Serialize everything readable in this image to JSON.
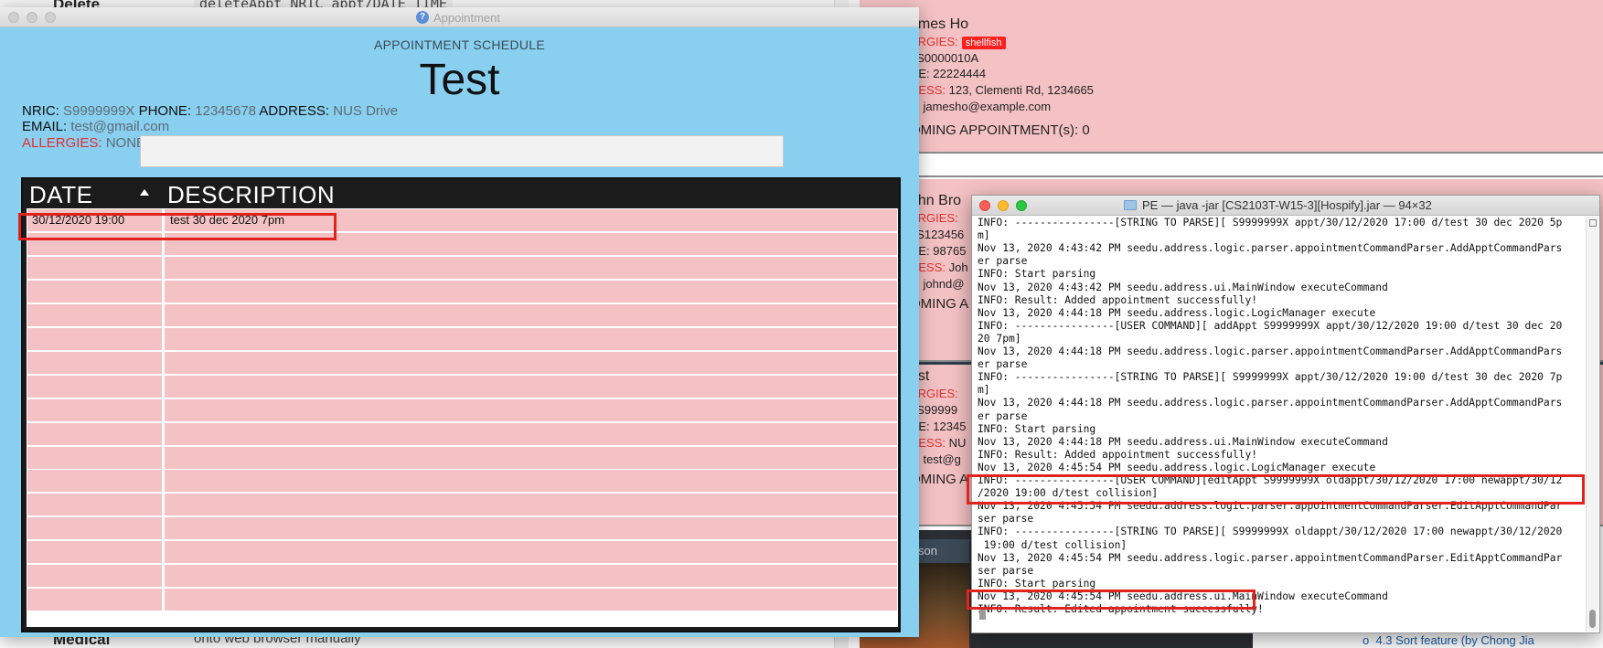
{
  "background": {
    "doc": {
      "delete_heading": "Delete",
      "delete_code": "deleteAppt NRIC appt/DATE TIME",
      "medical_heading": "Medical",
      "bottom_text": "onto web browser manually"
    },
    "patients": [
      {
        "name": "ames Ho",
        "allergies_label": "ERGIES:",
        "allergy_tag": "shellfish",
        "nric": ": S0000010A",
        "phone": "NE: 22224444",
        "address_label": "RESS:",
        "address": "123, Clementi Rd, 1234665",
        "email": "L: jamesho@example.com",
        "upcoming": "OMING APPOINTMENT(s): 0"
      },
      {
        "name": "ohn Bro",
        "allergies_label": "ERGIES:",
        "nric": ": S123456",
        "phone": "NE: 98765",
        "address_label": "RESS:",
        "address": "Joh",
        "email": "L: johnd@",
        "upcoming": "OMING A"
      },
      {
        "name": "est",
        "allergies_label": "ERGIES:",
        "nric": ": S99999",
        "phone": "NE: 12345",
        "address_label": "RESS:",
        "address": "NU",
        "email": "L: test@g",
        "upcoming": "OMING A"
      }
    ],
    "dark_tab": "son",
    "toc_item": "4.3 Sort feature (by Chong Jia"
  },
  "appointment_window": {
    "title": "Appointment",
    "schedule_header": "APPOINTMENT SCHEDULE",
    "patient_name": "Test",
    "nric_label": "NRIC:",
    "nric": "S9999999X",
    "phone_label": "PHONE:",
    "phone": "12345678",
    "address_label": "ADDRESS:",
    "address": "NUS Drive",
    "email_label": "EMAIL:",
    "email": "test@gmail.com",
    "allergies_label": "ALLERGIES:",
    "allergies": "NONE",
    "table": {
      "date_header": "DATE",
      "desc_header": "DESCRIPTION",
      "rows": [
        {
          "date": "30/12/2020 19:00",
          "description": "test 30 dec 2020 7pm"
        }
      ]
    }
  },
  "terminal": {
    "title": "PE — java -jar [CS2103T-W15-3][Hospify].jar — 94×32",
    "lines": [
      "INFO: ----------------[STRING TO PARSE][ S9999999X appt/30/12/2020 17:00 d/test 30 dec 2020 5p",
      "m]",
      "Nov 13, 2020 4:43:42 PM seedu.address.logic.parser.appointmentCommandParser.AddApptCommandPars",
      "er parse",
      "INFO: Start parsing",
      "Nov 13, 2020 4:43:42 PM seedu.address.ui.MainWindow executeCommand",
      "INFO: Result: Added appointment successfully!",
      "Nov 13, 2020 4:44:18 PM seedu.address.logic.LogicManager execute",
      "INFO: ----------------[USER COMMAND][ addAppt S9999999X appt/30/12/2020 19:00 d/test 30 dec 20",
      "20 7pm]",
      "Nov 13, 2020 4:44:18 PM seedu.address.logic.parser.appointmentCommandParser.AddApptCommandPars",
      "er parse",
      "INFO: ----------------[STRING TO PARSE][ S9999999X appt/30/12/2020 19:00 d/test 30 dec 2020 7p",
      "m]",
      "Nov 13, 2020 4:44:18 PM seedu.address.logic.parser.appointmentCommandParser.AddApptCommandPars",
      "er parse",
      "INFO: Start parsing",
      "Nov 13, 2020 4:44:18 PM seedu.address.ui.MainWindow executeCommand",
      "INFO: Result: Added appointment successfully!",
      "Nov 13, 2020 4:45:54 PM seedu.address.logic.LogicManager execute",
      "INFO: ----------------[USER COMMAND][editAppt S9999999X oldappt/30/12/2020 17:00 newappt/30/12",
      "/2020 19:00 d/test collision]",
      "Nov 13, 2020 4:45:54 PM seedu.address.logic.parser.appointmentCommandParser.EditApptCommandPar",
      "ser parse",
      "INFO: ----------------[STRING TO PARSE][ S9999999X oldappt/30/12/2020 17:00 newappt/30/12/2020",
      " 19:00 d/test collision]",
      "Nov 13, 2020 4:45:54 PM seedu.address.logic.parser.appointmentCommandParser.EditApptCommandPar",
      "ser parse",
      "INFO: Start parsing",
      "Nov 13, 2020 4:45:54 PM seedu.address.ui.MainWindow executeCommand",
      "INFO: Result: Edited appointment successfully!"
    ]
  },
  "colors": {
    "window_bg": "#88cff0",
    "row_pink": "#f4c2c4",
    "highlight_red": "#e0231d",
    "label_red": "#e53030"
  }
}
